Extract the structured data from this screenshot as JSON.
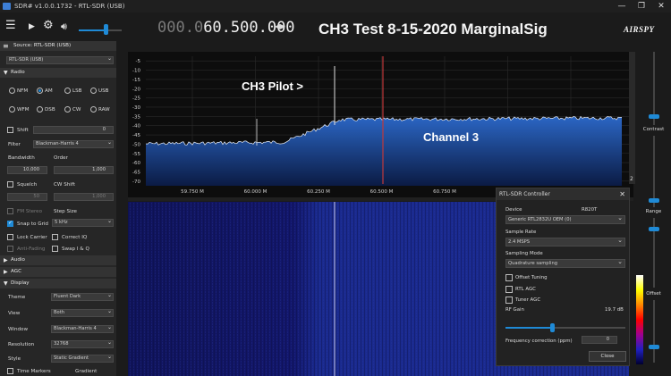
{
  "window": {
    "title": "SDR# v1.0.0.1732 - RTL-SDR (USB)",
    "controls": [
      "—",
      "❐",
      "✕"
    ]
  },
  "toolbar": {
    "icons": [
      "menu-icon",
      "play-icon",
      "gear-icon",
      "volume-icon"
    ],
    "frequency_dim": "000.0",
    "frequency_main": "60.500.000",
    "nav_arrows": "◂▸",
    "volume_level": 0.6
  },
  "plot": {
    "title": "CH3 Test 8-15-2020  MarginalSig",
    "annotation_pilot": "CH3 Pilot >",
    "annotation_channel": "Channel 3",
    "y_ticks": [
      "-5",
      "-10",
      "-15",
      "-20",
      "-25",
      "-30",
      "-35",
      "-40",
      "-45",
      "-50",
      "-55",
      "-60",
      "-65",
      "-70"
    ],
    "x_ticks": [
      "59.750 M",
      "60.000 M",
      "60.250 M",
      "60.500 M",
      "60.750 M",
      "61.000 M",
      "61.250 M"
    ],
    "scroll_label": "2",
    "marker_color": "#c0393b",
    "fill_color": "#1e4fa3"
  },
  "logo": "AIRSPY",
  "left": {
    "source_header": "Source: RTL-SDR (USB)",
    "source_value": "RTL-SDR (USB)",
    "radio_header": "Radio",
    "modes": [
      {
        "label": "NFM",
        "on": false
      },
      {
        "label": "AM",
        "on": true
      },
      {
        "label": "LSB",
        "on": false
      },
      {
        "label": "USB",
        "on": false
      },
      {
        "label": "WFM",
        "on": false
      },
      {
        "label": "DSB",
        "on": false
      },
      {
        "label": "CW",
        "on": false
      },
      {
        "label": "RAW",
        "on": false
      }
    ],
    "shift_label": "Shift",
    "shift_value": "0",
    "filter_label": "Filter",
    "filter_value": "Blackman-Harris 4",
    "bandwidth_label": "Bandwidth",
    "bandwidth_value": "10,000",
    "order_label": "Order",
    "order_value": "1,000",
    "squelch_label": "Squelch",
    "squelch_value": "50",
    "cwshift_label": "CW Shift",
    "cwshift_value": "1,000",
    "fmstereo_label": "FM Stereo",
    "stepsize_label": "Step Size",
    "snap_label": "Snap to Grid",
    "snap_value": "5 kHz",
    "lockcarrier_label": "Lock Carrier",
    "correctiq_label": "Correct IQ",
    "antifading_label": "Anti-Fading",
    "swapiq_label": "Swap I & Q",
    "audio_header": "Audio",
    "agc_header": "AGC",
    "display_header": "Display",
    "theme_label": "Theme",
    "theme_value": "Fluent Dark",
    "view_label": "View",
    "view_value": "Both",
    "window_label": "Window",
    "window_value": "Blackman-Harris 4",
    "resolution_label": "Resolution",
    "resolution_value": "32768",
    "style_label": "Style",
    "style_value": "Static Gradient",
    "timemarkers_label": "Time Markers",
    "gradient_label": "Gradient"
  },
  "right": {
    "contrast_label": "Contrast",
    "range_label": "Range",
    "offset_label": "Offset"
  },
  "dialog": {
    "title": "RTL-SDR Controller",
    "device_label": "Device",
    "device_chip": "R820T",
    "device_value": "Generic RTL2832U OEM (0)",
    "samplerate_label": "Sample Rate",
    "samplerate_value": "2.4 MSPS",
    "samplingmode_label": "Sampling Mode",
    "samplingmode_value": "Quadrature sampling",
    "offset_tuning": "Offset Tuning",
    "rtl_agc": "RTL AGC",
    "tuner_agc": "Tuner AGC",
    "rfgain_label": "RF Gain",
    "rfgain_value": "19.7 dB",
    "freqcorr_label": "Frequency correction (ppm)",
    "freqcorr_value": "0",
    "close_label": "Close"
  }
}
